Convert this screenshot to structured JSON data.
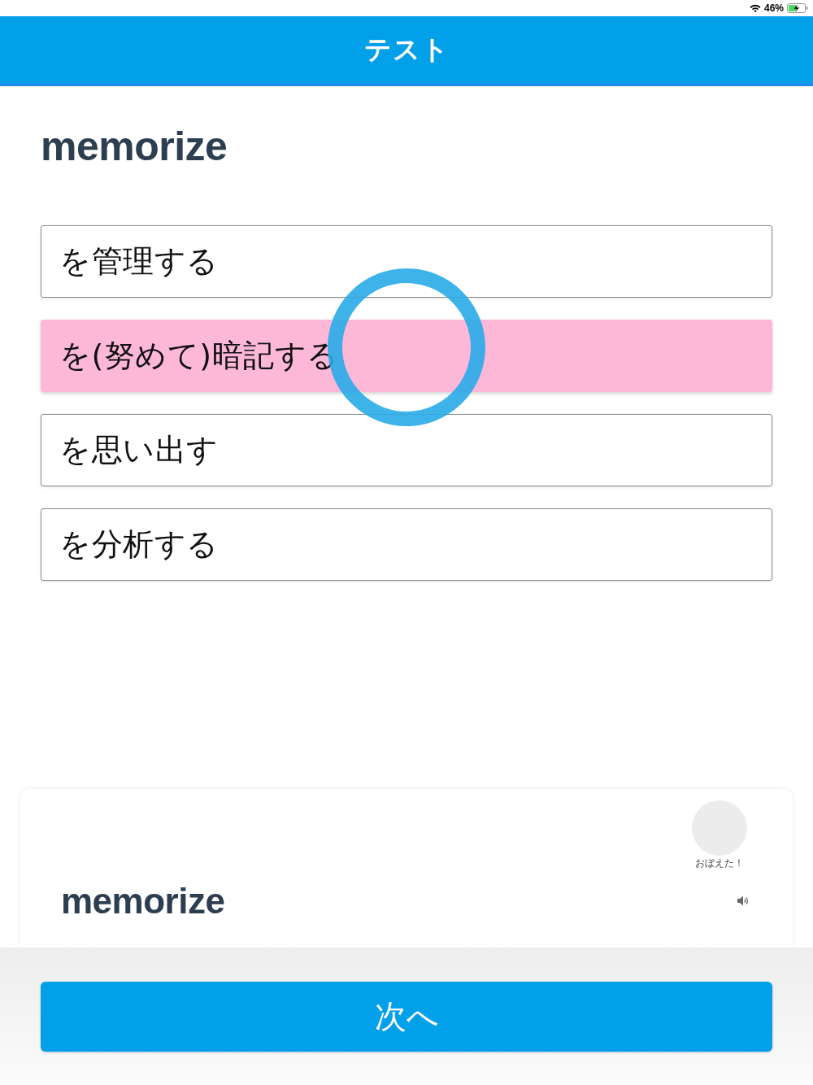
{
  "status_bar": {
    "battery": "46%"
  },
  "header": {
    "title": "テスト"
  },
  "question": {
    "word": "memorize"
  },
  "choices": [
    {
      "text": "を管理する",
      "selected": false
    },
    {
      "text": "を(努めて)暗記する",
      "selected": true
    },
    {
      "text": "を思い出す",
      "selected": false
    },
    {
      "text": "を分析する",
      "selected": false
    }
  ],
  "result_mark": {
    "kind": "correct"
  },
  "word_card": {
    "memorized_label": "おぼえた！",
    "word": "memorize"
  },
  "next_button": {
    "label": "次へ"
  }
}
